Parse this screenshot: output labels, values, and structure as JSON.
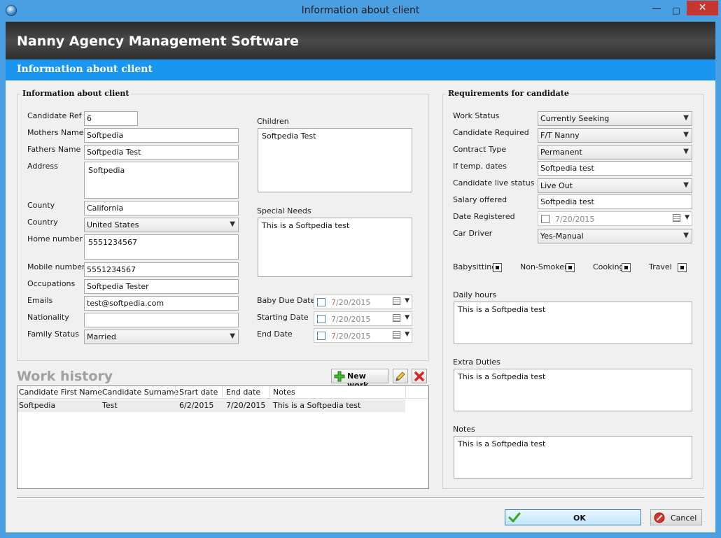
{
  "window": {
    "title": "Information about client",
    "min_glyph": "—",
    "max_glyph": "□",
    "close_glyph": "✕"
  },
  "banner": {
    "title": "Nanny Agency Management Software",
    "subtitle": "Information about client"
  },
  "client_info": {
    "group_title": "Information about client",
    "candidate_ref_label": "Candidate Ref #",
    "candidate_ref": "6",
    "mothers_name_label": "Mothers Name",
    "mothers_name": "Softpedia",
    "fathers_name_label": "Fathers Name",
    "fathers_name": "Softpedia Test",
    "address_label": "Address",
    "address": "Softpedia",
    "county_label": "County",
    "county": "California",
    "country_label": "Country",
    "country": "United States",
    "home_number_label": "Home number",
    "home_number": "5551234567",
    "mobile_number_label": "Mobile number",
    "mobile_number": "5551234567",
    "occupations_label": "Occupations",
    "occupations": "Softpedia Tester",
    "emails_label": "Emails",
    "emails": "test@softpedia.com",
    "nationality_label": "Nationality",
    "nationality": "",
    "family_status_label": "Family Status",
    "family_status": "Married",
    "children_label": "Children",
    "children": "Softpedia Test",
    "special_needs_label": "Special Needs",
    "special_needs": "This is a Softpedia test",
    "baby_due_date_label": "Baby Due Date",
    "baby_due_date": "7/20/2015",
    "starting_date_label": "Starting Date",
    "starting_date": "7/20/2015",
    "end_date_label": "End Date",
    "end_date": "7/20/2015"
  },
  "work_history": {
    "title": "Work history",
    "new_work_label": "New work",
    "columns": [
      "Candidate First Name",
      "Candidate Surname",
      "Srart date",
      "End date",
      "Notes"
    ],
    "rows": [
      [
        "Softpedia",
        "Test",
        "6/2/2015",
        "7/20/2015",
        "This is a Softpedia test"
      ]
    ]
  },
  "requirements": {
    "group_title": "Requirements for candidate",
    "work_status_label": "Work Status",
    "work_status": "Currently Seeking",
    "candidate_required_label": "Candidate Required",
    "candidate_required": "F/T Nanny",
    "contract_type_label": "Contract Type",
    "contract_type": "Permanent",
    "temp_dates_label": "If temp. dates",
    "temp_dates": "Softpedia test",
    "live_status_label": "Candidate live status",
    "live_status": "Live Out",
    "salary_label": "Salary offered",
    "salary": "Softpedia test",
    "date_registered_label": "Date Registered",
    "date_registered": "7/20/2015",
    "car_driver_label": "Car Driver",
    "car_driver": "Yes-Manual",
    "babysitting_label": "Babysitting",
    "non_smoker_label": "Non-Smoker",
    "cooking_label": "Cooking",
    "travel_label": "Travel",
    "daily_hours_label": "Daily hours",
    "daily_hours": "This is a Softpedia test",
    "extra_duties_label": "Extra Duties",
    "extra_duties": "This is a Softpedia test",
    "notes_label": "Notes",
    "notes": "This is a Softpedia test"
  },
  "footer": {
    "ok_label": "OK",
    "cancel_label": "Cancel"
  },
  "colors": {
    "accent": "#1a95f0",
    "close": "#c7372f"
  }
}
